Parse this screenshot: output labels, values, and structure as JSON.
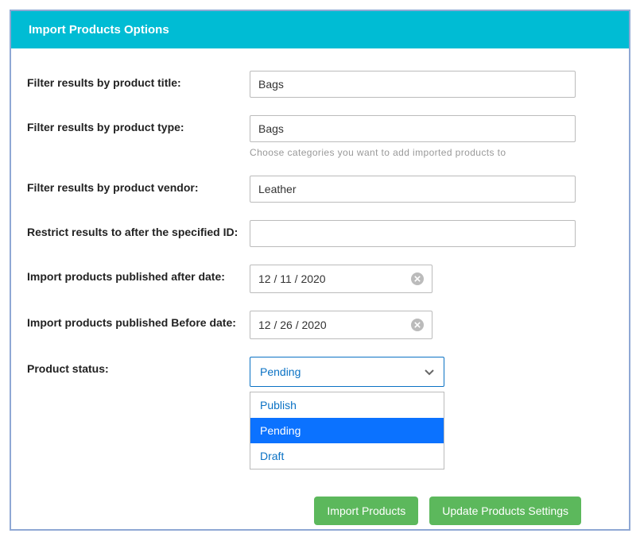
{
  "header": {
    "title": "Import Products Options"
  },
  "labels": {
    "filter_title": "Filter results by product title:",
    "filter_type": "Filter results by product type:",
    "filter_vendor": "Filter results by product vendor:",
    "restrict_id": "Restrict results to after the specified ID:",
    "published_after": "Import products published after date:",
    "published_before": "Import products published Before date:",
    "status": "Product status:"
  },
  "fields": {
    "title_value": "Bags",
    "type_value": "Bags",
    "type_helper": "Choose categories you want to add imported products to",
    "vendor_value": "Leather",
    "restrict_id_value": "",
    "after_date": "12 / 11 / 2020",
    "before_date": "12 / 26 / 2020"
  },
  "status_select": {
    "selected": "Pending",
    "options": [
      "Publish",
      "Pending",
      "Draft"
    ]
  },
  "buttons": {
    "import": "Import Products",
    "update": "Update Products Settings"
  }
}
